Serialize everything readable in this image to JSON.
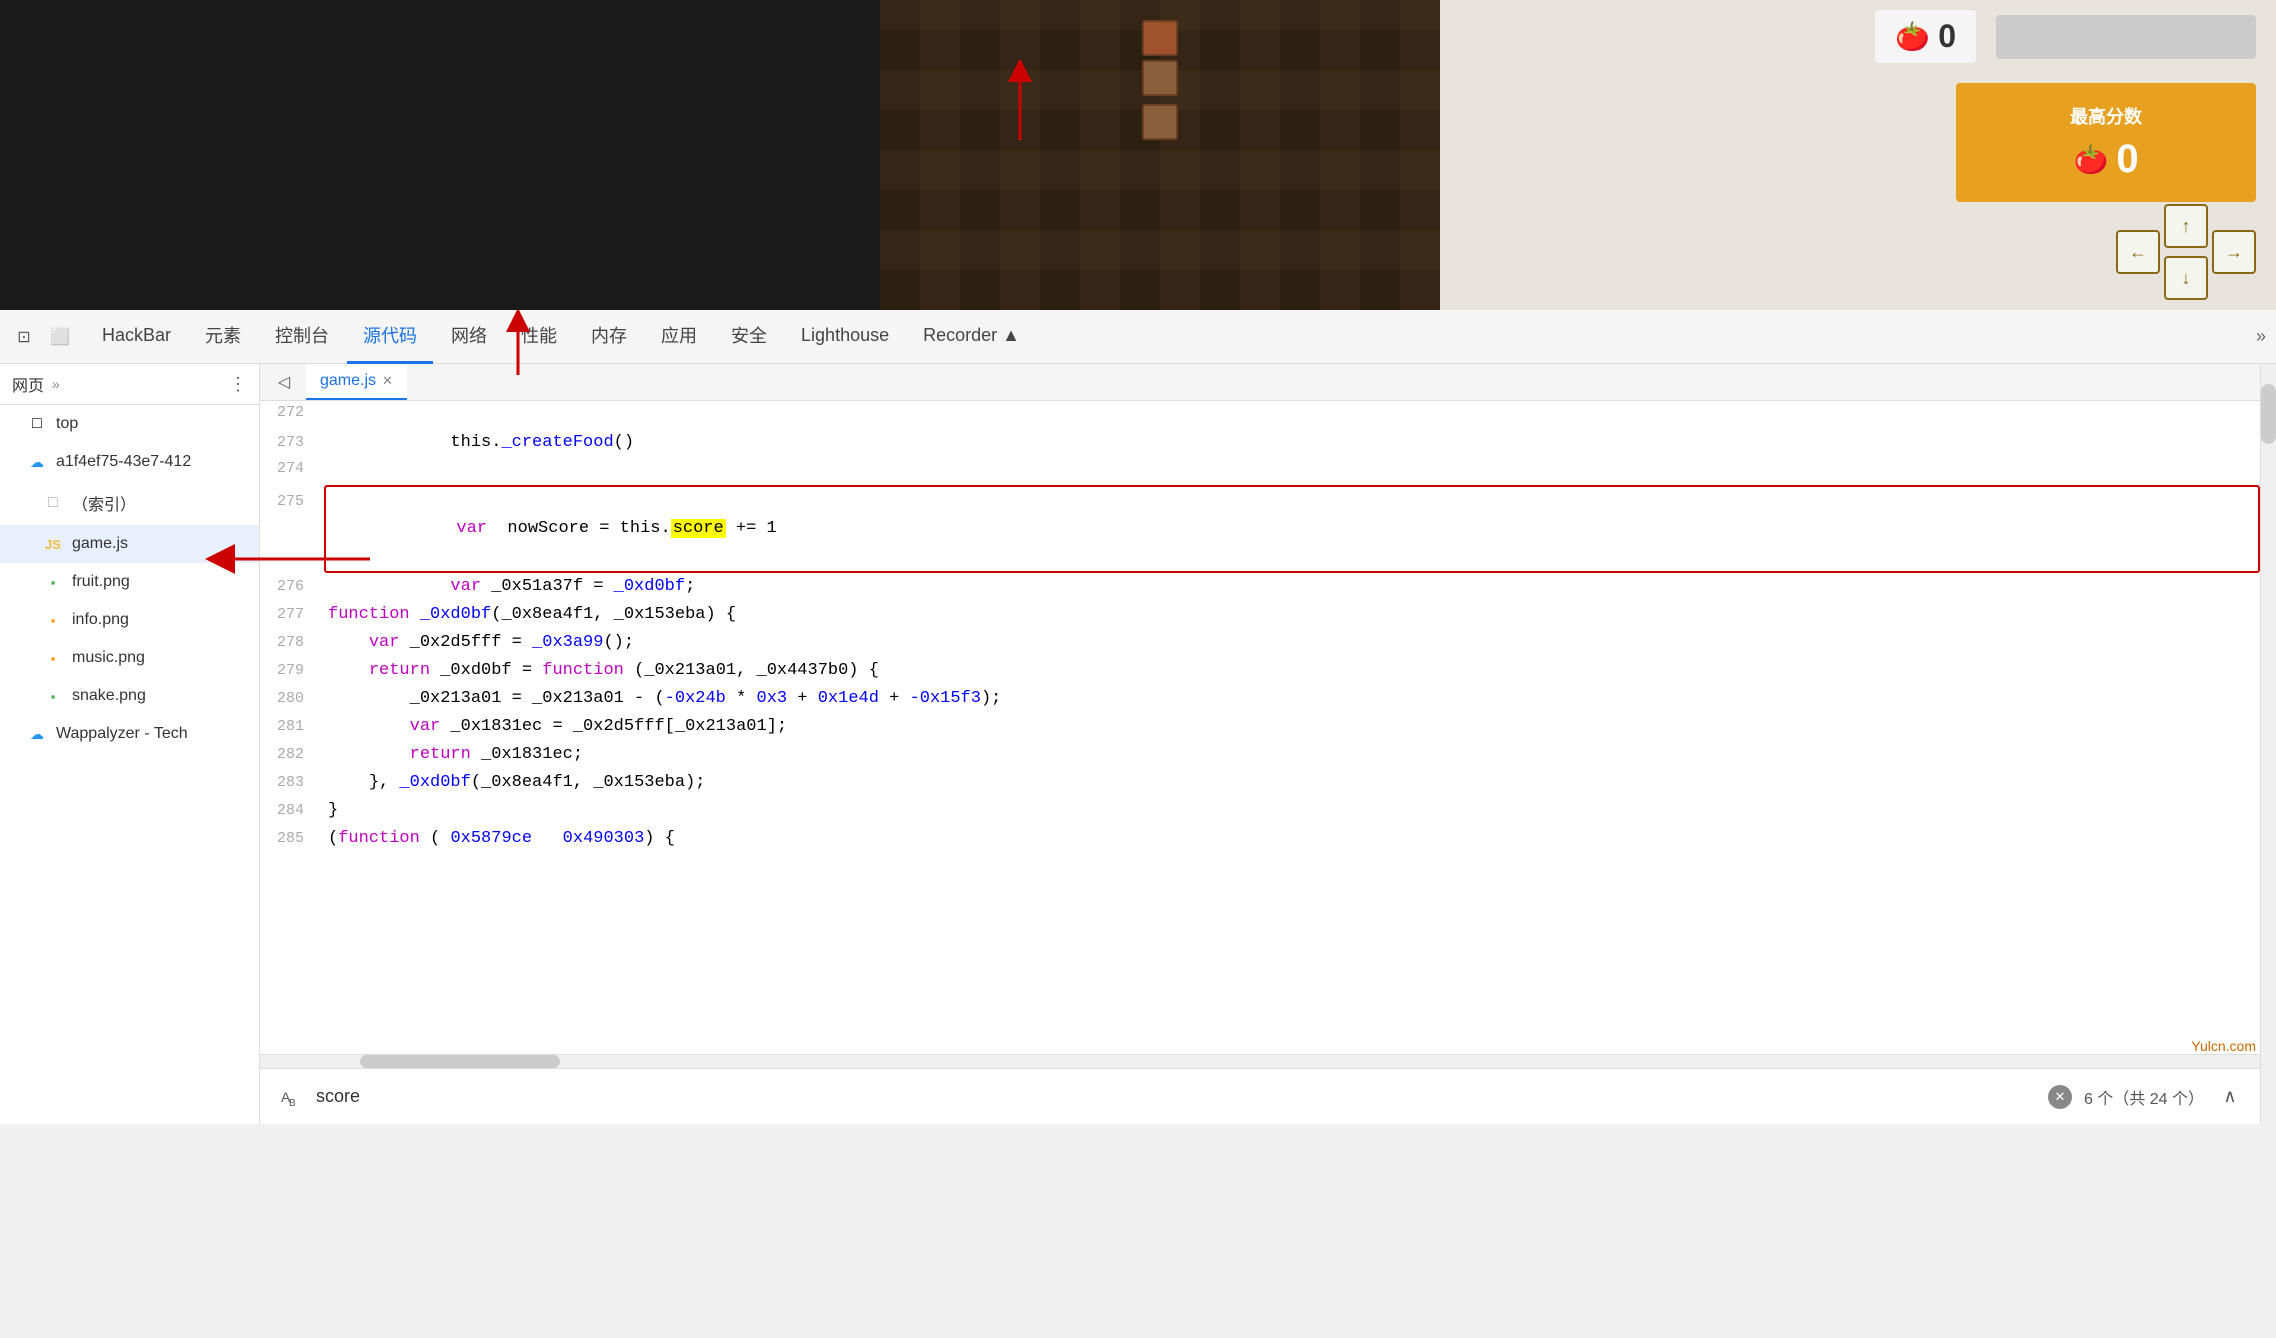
{
  "game": {
    "topScoreLabel": "最高分数",
    "currentScore": "0",
    "topScore": "0"
  },
  "devtools": {
    "tabs": [
      {
        "label": "HackBar",
        "active": false
      },
      {
        "label": "元素",
        "active": false
      },
      {
        "label": "控制台",
        "active": false
      },
      {
        "label": "源代码",
        "active": true
      },
      {
        "label": "网络",
        "active": false
      },
      {
        "label": "性能",
        "active": false
      },
      {
        "label": "内存",
        "active": false
      },
      {
        "label": "应用",
        "active": false
      },
      {
        "label": "安全",
        "active": false
      },
      {
        "label": "Lighthouse",
        "active": false
      },
      {
        "label": "Recorder ▲",
        "active": false
      },
      {
        "label": "»",
        "active": false
      }
    ]
  },
  "sidebar": {
    "header": "网页",
    "moreBtn": "»",
    "items": [
      {
        "label": "top",
        "type": "folder",
        "indent": 0
      },
      {
        "label": "a1f4ef75-43e7-412",
        "type": "cloud",
        "indent": 0
      },
      {
        "label": "（索引）",
        "type": "file-doc",
        "indent": 1
      },
      {
        "label": "game.js",
        "type": "file-js",
        "indent": 1
      },
      {
        "label": "fruit.png",
        "type": "file-png-green",
        "indent": 1
      },
      {
        "label": "info.png",
        "type": "file-png-orange",
        "indent": 1
      },
      {
        "label": "music.png",
        "type": "file-png-orange",
        "indent": 1
      },
      {
        "label": "snake.png",
        "type": "file-png-green",
        "indent": 1
      },
      {
        "label": "Wappalyzer - Tech",
        "type": "cloud",
        "indent": 0
      }
    ]
  },
  "editor": {
    "tabLabel": "game.js",
    "lines": [
      {
        "num": "272",
        "code": ""
      },
      {
        "num": "273",
        "code": "            this._createFood()"
      },
      {
        "num": "274",
        "code": ""
      },
      {
        "num": "275",
        "code": "            var nowScore = this.score += 1",
        "highlight": true
      },
      {
        "num": "276",
        "code": "            var _0x51a37f = _0xd0bf;"
      },
      {
        "num": "277",
        "code": "function _0xd0bf(_0x8ea4f1, _0x153eba) {"
      },
      {
        "num": "278",
        "code": "    var _0x2d5fff = _0x3a99();"
      },
      {
        "num": "279",
        "code": "    return _0xd0bf = function (_0x213a01, _0x4437b0) {"
      },
      {
        "num": "280",
        "code": "        _0x213a01 = _0x213a01 - (-0x24b * 0x3 + 0x1e4d + -0x15f3);"
      },
      {
        "num": "281",
        "code": "        var _0x1831ec = _0x2d5fff[_0x213a01];"
      },
      {
        "num": "282",
        "code": "        return _0x1831ec;"
      },
      {
        "num": "283",
        "code": "    }, _0xd0bf(_0x8ea4f1, _0x153eba);"
      },
      {
        "num": "284",
        "code": "}"
      },
      {
        "num": "285",
        "code": "(function ( 0x5879ce   0x490303) {"
      }
    ]
  },
  "search": {
    "placeholder": "score",
    "value": "score",
    "countText": "6 个（共 24 个）"
  },
  "watermark": "Yulcn.com",
  "annotations": {
    "arrowToGamejs": "red arrow pointing left toward game.js",
    "arrowToScore": "red arrow pointing up toward 源代码 tab"
  }
}
